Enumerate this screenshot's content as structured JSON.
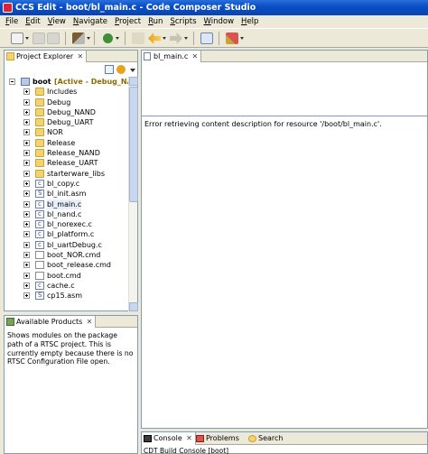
{
  "window": {
    "title": "CCS Edit - boot/bl_main.c - Code Composer Studio"
  },
  "menu": [
    {
      "u": "F",
      "rest": "ile"
    },
    {
      "u": "E",
      "rest": "dit"
    },
    {
      "u": "V",
      "rest": "iew"
    },
    {
      "u": "N",
      "rest": "avigate"
    },
    {
      "u": "P",
      "rest": "roject"
    },
    {
      "u": "R",
      "rest": "un"
    },
    {
      "u": "S",
      "rest": "cripts"
    },
    {
      "u": "W",
      "rest": "indow"
    },
    {
      "u": "H",
      "rest": "elp"
    }
  ],
  "project_explorer": {
    "tab_label": "Project Explorer",
    "close_glyph": "✕",
    "project": {
      "name": "boot",
      "status": "[Active - Debug_NAND"
    },
    "items": [
      {
        "label": "Includes",
        "kind": "folder"
      },
      {
        "label": "Debug",
        "kind": "folder"
      },
      {
        "label": "Debug_NAND",
        "kind": "folder"
      },
      {
        "label": "Debug_UART",
        "kind": "folder"
      },
      {
        "label": "NOR",
        "kind": "folder"
      },
      {
        "label": "Release",
        "kind": "folder"
      },
      {
        "label": "Release_NAND",
        "kind": "folder"
      },
      {
        "label": "Release_UART",
        "kind": "folder"
      },
      {
        "label": "starterware_libs",
        "kind": "folder"
      },
      {
        "label": "bl_copy.c",
        "kind": "c"
      },
      {
        "label": "bl_init.asm",
        "kind": "asm"
      },
      {
        "label": "bl_main.c",
        "kind": "c",
        "selected": true
      },
      {
        "label": "bl_nand.c",
        "kind": "c"
      },
      {
        "label": "bl_norexec.c",
        "kind": "c"
      },
      {
        "label": "bl_platform.c",
        "kind": "c"
      },
      {
        "label": "bl_uartDebug.c",
        "kind": "c"
      },
      {
        "label": "boot_NOR.cmd",
        "kind": "cmd"
      },
      {
        "label": "boot_release.cmd",
        "kind": "cmd"
      },
      {
        "label": "boot.cmd",
        "kind": "cmd"
      },
      {
        "label": "cache.c",
        "kind": "c"
      },
      {
        "label": "cp15.asm",
        "kind": "asm"
      }
    ]
  },
  "available_products": {
    "tab_label": "Available Products",
    "close_glyph": "✕",
    "description": "Shows modules on the package path of a RTSC project. This is currently empty because there is no RTSC Configuration File open."
  },
  "editor": {
    "tab_label": "bl_main.c",
    "close_glyph": "✕",
    "message": "Error retrieving content description for resource '/boot/bl_main.c'."
  },
  "bottom_panel": {
    "tabs": [
      {
        "label": "Console",
        "close_glyph": "✕"
      },
      {
        "label": "Problems"
      },
      {
        "label": "Search"
      }
    ],
    "console_line": "CDT Build Console [boot]"
  }
}
